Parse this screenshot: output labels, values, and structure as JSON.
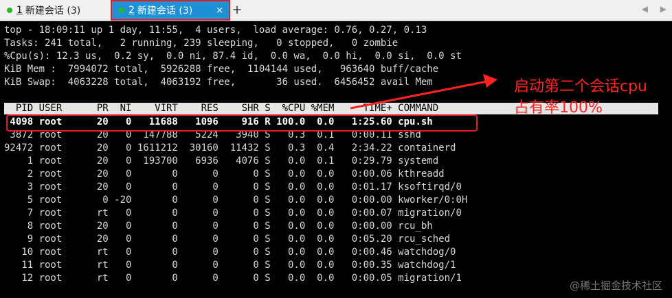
{
  "tabs": [
    {
      "num": "1",
      "label": "新建会话 (3)",
      "active": false
    },
    {
      "num": "2",
      "label": "新建会话 (3)",
      "active": true
    }
  ],
  "tab_close": "×",
  "new_tab": "+",
  "nav_prev": "◀",
  "nav_next": "▶",
  "summary": {
    "line1": "top - 18:09:11 up 1 day, 11:55,  4 users,  load average: 0.76, 0.27, 0.13",
    "line2": "Tasks: 241 total,   2 running, 239 sleeping,   0 stopped,   0 zombie",
    "line3": "%Cpu(s): 12.3 us,  0.2 sy,  0.0 ni, 87.4 id,  0.0 wa,  0.0 hi,  0.0 si,  0.0 st",
    "line4": "KiB Mem :  7994072 total,  5926288 free,  1104144 used,   963640 buff/cache",
    "line5": "KiB Swap:  4063228 total,  4063192 free,       36 used.  6456452 avail Mem"
  },
  "columns": "  PID USER      PR  NI    VIRT    RES    SHR S  %CPU %MEM     TIME+ COMMAND",
  "processes": [
    " 4098 root      20   0   11688   1096    916 R 100.0  0.0   1:25.60 cpu.sh",
    " 3872 root      20   0  147788   5224   3940 S   0.3  0.1   0:00.11 sshd",
    "92472 root      20   0 1611212  30160  11432 S   0.3  0.4   2:34.22 containerd",
    "    1 root      20   0  193700   6936   4076 S   0.0  0.1   0:29.79 systemd",
    "    2 root      20   0       0      0      0 S   0.0  0.0   0:00.06 kthreadd",
    "    3 root      20   0       0      0      0 S   0.0  0.0   0:01.17 ksoftirqd/0",
    "    5 root       0 -20       0      0      0 S   0.0  0.0   0:00.00 kworker/0:0H",
    "    7 root      rt   0       0      0      0 S   0.0  0.0   0:00.07 migration/0",
    "    8 root      20   0       0      0      0 S   0.0  0.0   0:00.00 rcu_bh",
    "    9 root      20   0       0      0      0 S   0.0  0.0   0:05.20 rcu_sched",
    "   10 root      rt   0       0      0      0 S   0.0  0.0   0:00.46 watchdog/0",
    "   11 root      rt   0       0      0      0 S   0.0  0.0   0:00.35 watchdog/1",
    "   12 root      rt   0       0      0      0 S   0.0  0.0   0:00.05 migration/1"
  ],
  "annotation": {
    "line1": "启动第二个会话cpu",
    "line2": "占有率100%"
  },
  "watermark": "@稀土掘金技术社区",
  "colors": {
    "tab_active": "#1e90d6",
    "annotation": "#ff2222",
    "session_dot": "#2bb52b"
  }
}
